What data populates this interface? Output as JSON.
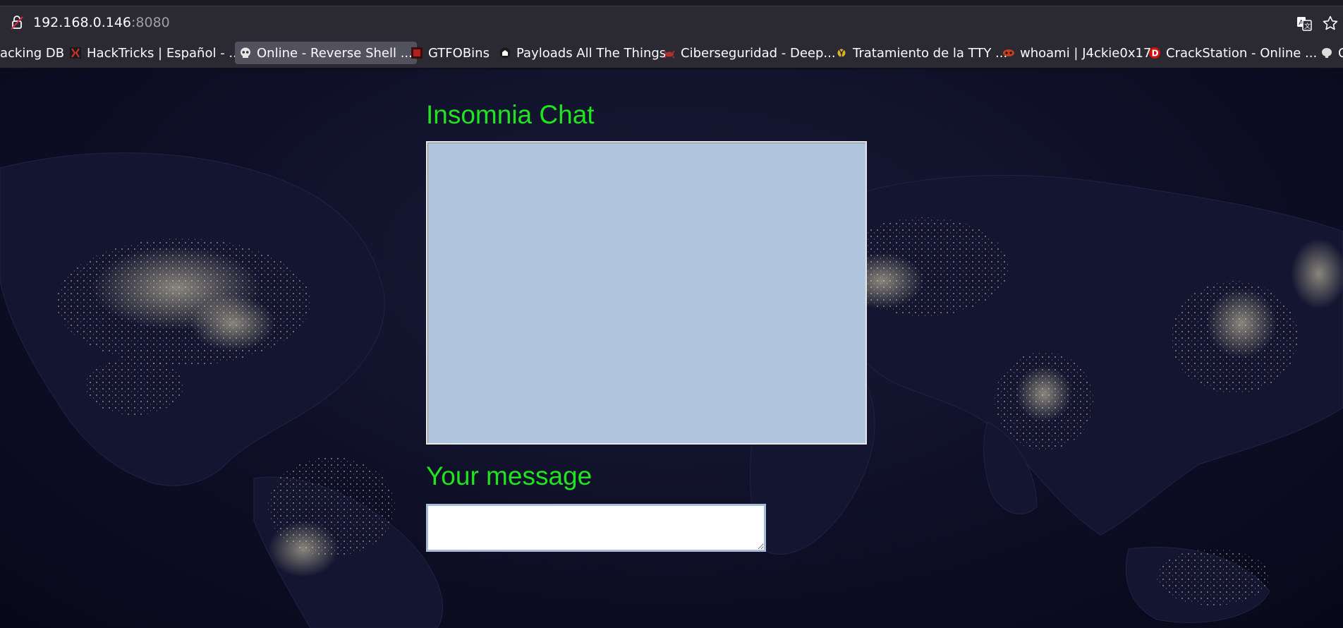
{
  "browser": {
    "url_host": "192.168.0.146",
    "url_port": ":8080",
    "bookmarks": [
      {
        "label": "acking DB",
        "icon": "bookmark-favicon",
        "color": "#2b2a33"
      },
      {
        "label": "HackTricks | Español - ...",
        "icon": "hacktricks-favicon",
        "color": "#c0392b"
      },
      {
        "label": "Online - Reverse Shell ...",
        "icon": "skull-favicon",
        "color": "#e0e0e0"
      },
      {
        "label": "GTFOBins",
        "icon": "gtfobins-favicon",
        "color": "#b02020"
      },
      {
        "label": "Payloads All The Things",
        "icon": "payloads-favicon",
        "color": "#ffffff"
      },
      {
        "label": "Ciberseguridad - Deep...",
        "icon": "crab-favicon",
        "color": "#b03030"
      },
      {
        "label": "Tratamiento de la TTY ...",
        "icon": "radiation-favicon",
        "color": "#e0b030"
      },
      {
        "label": "whoami | J4ckie0x17",
        "icon": "whoami-favicon",
        "color": "#c04020"
      },
      {
        "label": "CrackStation - Online ...",
        "icon": "crackstation-favicon",
        "color": "#d01010"
      },
      {
        "label": "C",
        "icon": "brain-favicon",
        "color": "#dddddd"
      }
    ]
  },
  "page": {
    "title": "Insomnia Chat",
    "message_label": "Your message",
    "message_value": "",
    "accent_color": "#1fe41f",
    "chat_bg_color": "#b0c4de"
  }
}
